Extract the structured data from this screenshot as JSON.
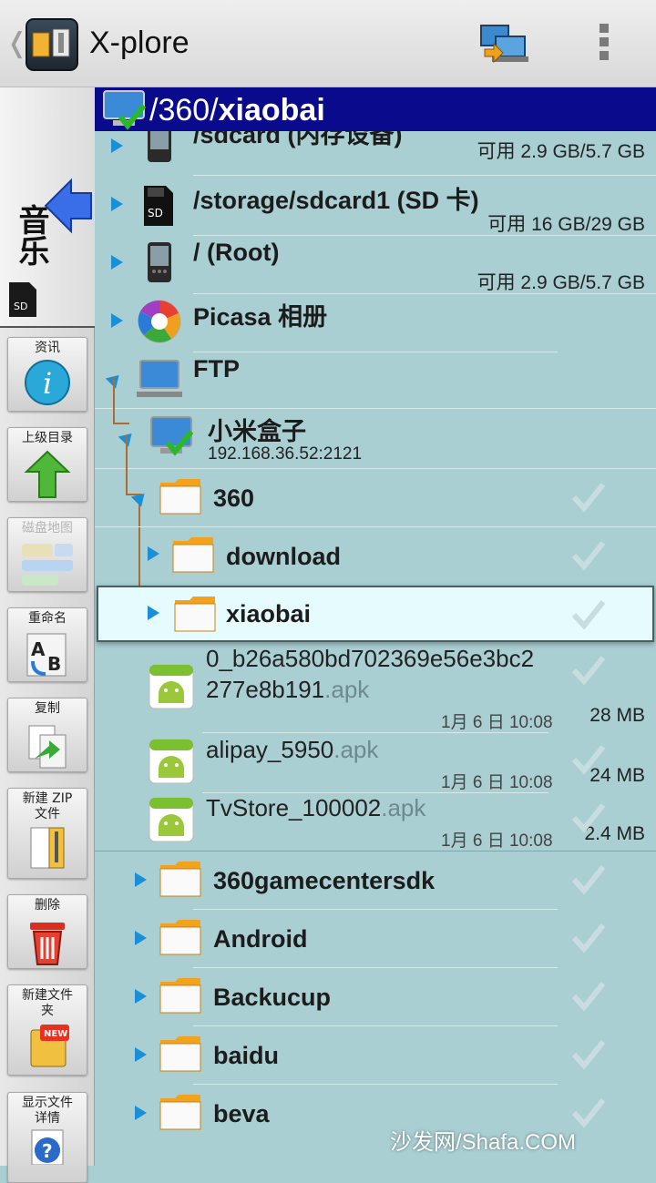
{
  "app": {
    "title": "X-plore"
  },
  "path": {
    "prefix": "/360/",
    "current": "xiaobai"
  },
  "volume": {
    "label": "音乐"
  },
  "tools": [
    {
      "label": "资讯"
    },
    {
      "label": "上级目录"
    },
    {
      "label": "磁盘地图"
    },
    {
      "label": "重命名"
    },
    {
      "label": "复制"
    },
    {
      "label": "新建 ZIP 文件"
    },
    {
      "label": "删除"
    },
    {
      "label": "新建文件夹"
    },
    {
      "label": "显示文件详情"
    }
  ],
  "storage": [
    {
      "name": "/sdcard (内存设备)",
      "free": "可用 2.9 GB/5.7 GB"
    },
    {
      "name": "/storage/sdcard1 (SD 卡)",
      "free": "可用 16 GB/29 GB"
    },
    {
      "name": "/ (Root)",
      "free": "可用 2.9 GB/5.7 GB"
    },
    {
      "name": "Picasa 相册"
    },
    {
      "name": "FTP"
    }
  ],
  "ftp_server": {
    "name": "小米盒子",
    "address": "192.168.36.52:2121"
  },
  "folders_top": [
    {
      "name": "360"
    },
    {
      "name": "download"
    },
    {
      "name": "xiaobai"
    }
  ],
  "files": [
    {
      "name_line1": "0_b26a580bd702369e56e3bc2",
      "name_line2": "277e8b191",
      "ext": ".apk",
      "date": "1月 6 日 10:08",
      "size": "28 MB"
    },
    {
      "name": "alipay_5950",
      "ext": ".apk",
      "date": "1月 6 日 10:08",
      "size": "24 MB"
    },
    {
      "name": "TvStore_100002",
      "ext": ".apk",
      "date": "1月 6 日 10:08",
      "size": "2.4 MB"
    }
  ],
  "folders_bottom": [
    {
      "name": "360gamecentersdk"
    },
    {
      "name": "Android"
    },
    {
      "name": "Backucup"
    },
    {
      "name": "baidu"
    },
    {
      "name": "beva"
    }
  ],
  "watermark": "沙发网/Shafa.COM",
  "colors": {
    "path_bar": "#0a0a8c",
    "list_bg": "#a9cfd3",
    "expander": "#1a8fd8",
    "selected": "#e6fbfd"
  }
}
